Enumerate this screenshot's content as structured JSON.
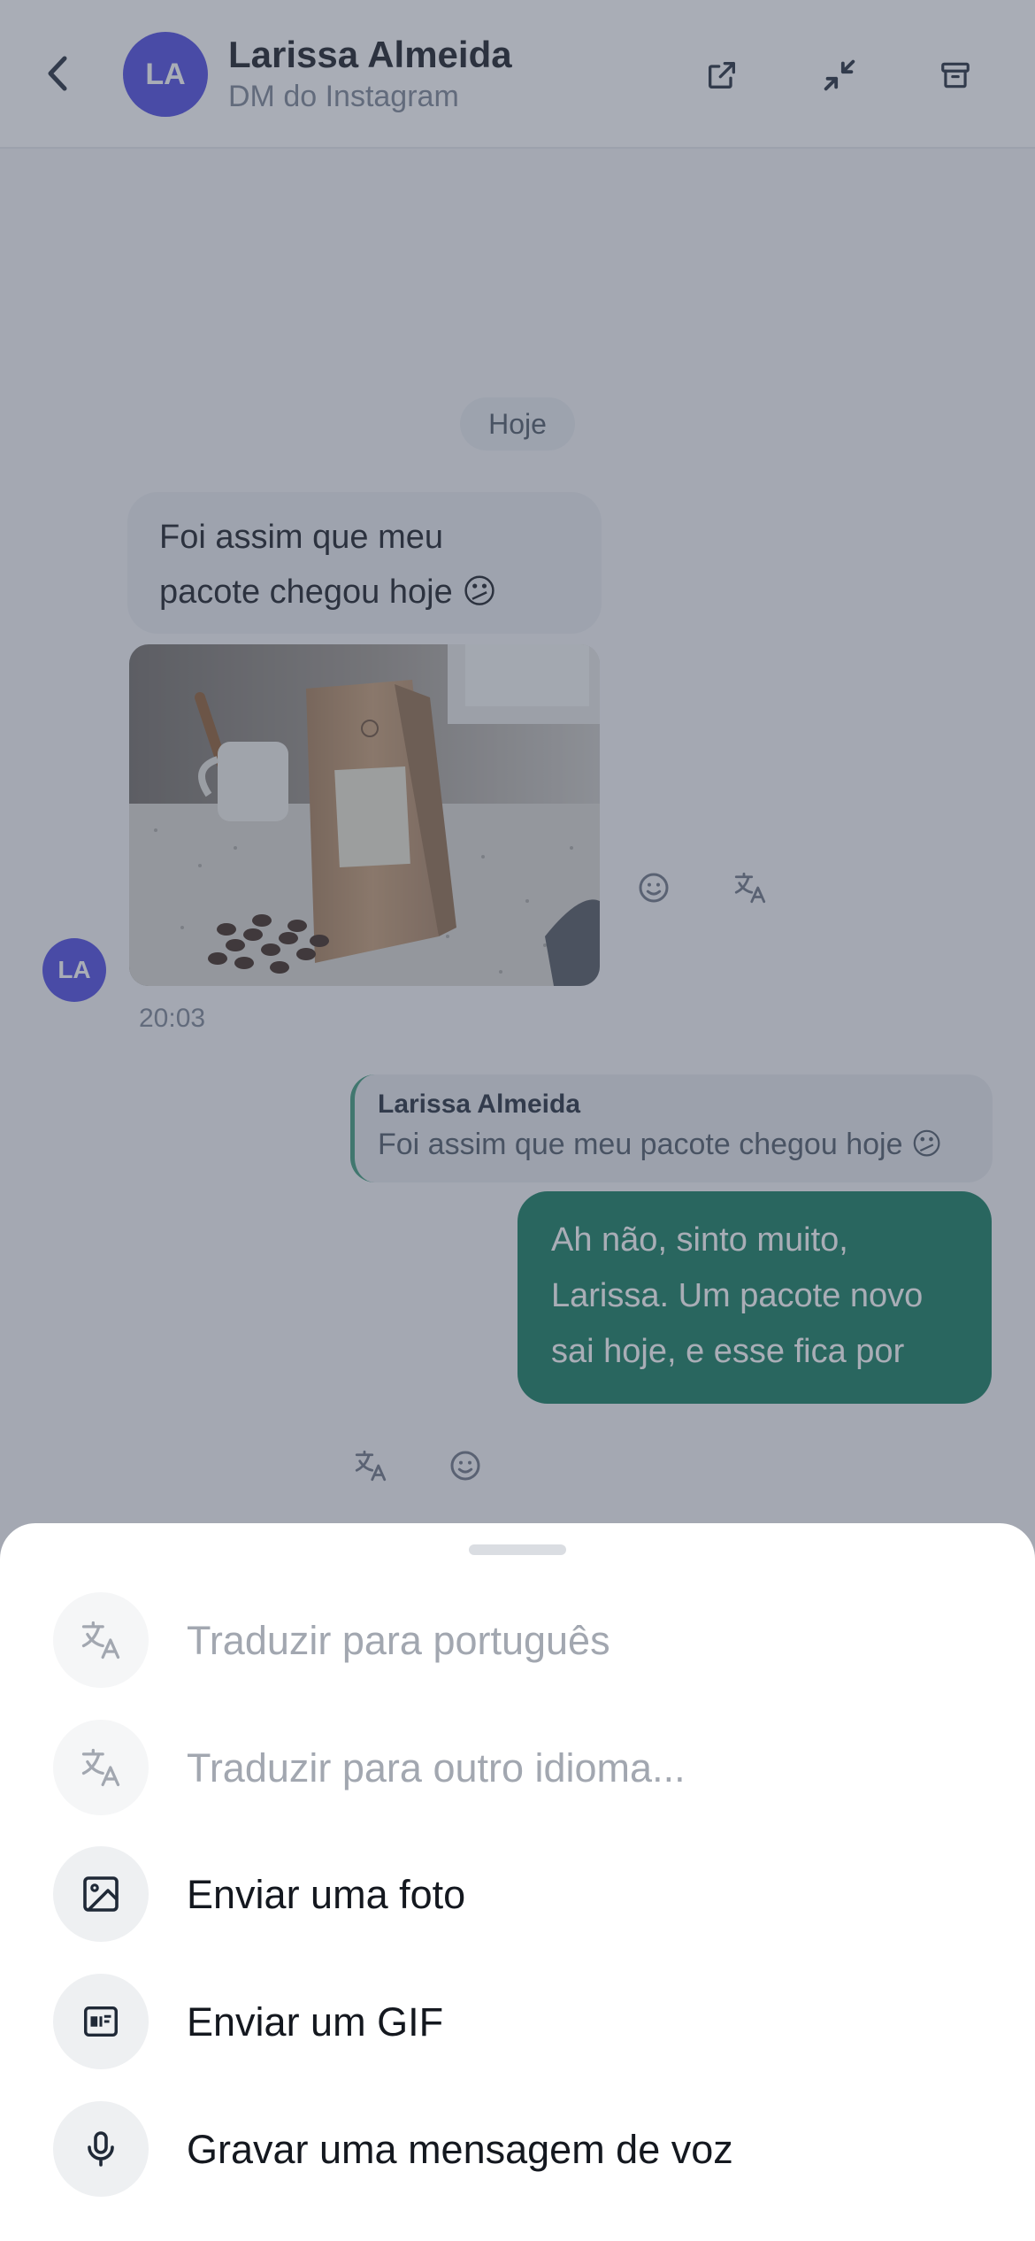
{
  "header": {
    "avatar_initials": "LA",
    "title": "Larissa Almeida",
    "subtitle": "DM do Instagram",
    "icons": [
      "back-chevron-icon",
      "open-external-icon",
      "minimize-icon",
      "archive-icon"
    ]
  },
  "chat": {
    "day_label": "Hoje",
    "incoming": {
      "text_line1": "Foi assim que meu",
      "text_line2": "pacote chegou hoje 😕",
      "time": "20:03",
      "avatar_initials": "LA"
    },
    "reply_quote": {
      "name": "Larissa Almeida",
      "text": "Foi assim que meu pacote chegou hoje 😕"
    },
    "outgoing": {
      "line1": "Ah não, sinto muito,",
      "line2": "Larissa. Um pacote novo",
      "line3": "sai hoje, e esse fica por"
    }
  },
  "sheet": {
    "items": [
      {
        "label": "Traduzir para português",
        "icon": "translate-icon",
        "enabled": false
      },
      {
        "label": "Traduzir para outro idioma...",
        "icon": "translate-icon",
        "enabled": false
      },
      {
        "label": "Enviar uma foto",
        "icon": "image-icon",
        "enabled": true
      },
      {
        "label": "Enviar um GIF",
        "icon": "gif-icon",
        "enabled": true
      },
      {
        "label": "Gravar uma mensagem de voz",
        "icon": "microphone-icon",
        "enabled": true
      }
    ]
  },
  "colors": {
    "accent_green": "#0f7a5c",
    "avatar_indigo": "#4a47e0",
    "overlay": "#485064"
  }
}
